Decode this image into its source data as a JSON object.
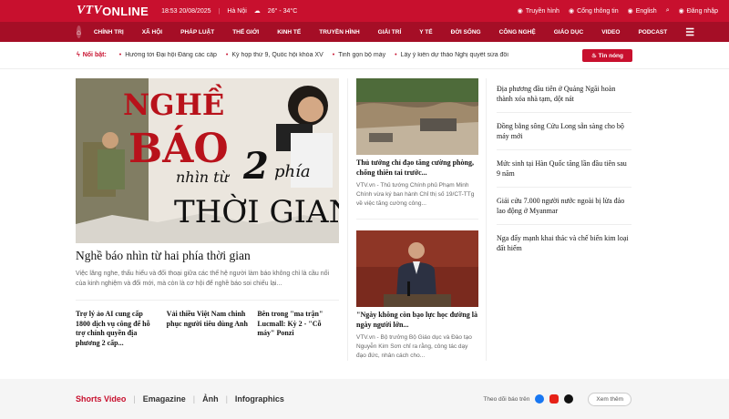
{
  "header": {
    "logo_vtv": "VTV",
    "logo_online": "ONLINE",
    "time": "18:53 20/08/2025",
    "location": "Hà Nội",
    "weather": "26° - 34°C",
    "links": [
      {
        "label": "Truyền hình",
        "icon": "tv-icon"
      },
      {
        "label": "Cổng thông tin",
        "icon": "portal-icon"
      },
      {
        "label": "English",
        "icon": "globe-icon"
      }
    ],
    "login": "Đăng nhập",
    "brand_color": "#c8102e"
  },
  "nav": {
    "items": [
      "CHÍNH TRỊ",
      "XÃ HỘI",
      "PHÁP LUẬT",
      "THẾ GIỚI",
      "KINH TẾ",
      "TRUYỀN HÌNH",
      "GIẢI TRÍ",
      "Y TẾ",
      "ĐỜI SỐNG",
      "CÔNG NGHỆ",
      "GIÁO DỤC",
      "VIDEO",
      "PODCAST"
    ]
  },
  "ticker": {
    "label": "Nổi bật:",
    "items": [
      "Hướng tới Đại hội Đảng các cấp",
      "Kỳ họp thứ 9, Quốc hội khóa XV",
      "Tinh gọn bộ máy",
      "Lấy ý kiến dự thảo Nghị quyết sửa đổi"
    ],
    "hot_button": "Tin nóng"
  },
  "hero": {
    "image_text_1": "NGHỀ",
    "image_text_2": "BÁO",
    "image_text_3": "nhìn từ",
    "image_text_4": "2",
    "image_text_5": "phía",
    "image_text_6": "THỜI GIAN",
    "title": "Nghề báo nhìn từ hai phía thời gian",
    "desc": "Việc lăng nghe, thấu hiểu và đối thoại giữa các thế hệ người làm báo không chỉ là cầu nối của kinh nghiệm và đổi mới, mà còn là cơ hội để nghề báo soi chiếu lại..."
  },
  "sub_stories": [
    "Trợ lý ảo AI cung cấp 1800 dịch vụ công để hỗ trợ chính quyền địa phương 2 cấp...",
    "Vải thiều Việt Nam chinh phục người tiêu dùng Anh",
    "Bên trong \"ma trận\" Lucmall: Kỳ 2 - \"Cỗ máy\" Ponzi"
  ],
  "cards": [
    {
      "title": "Thủ tướng chỉ đạo tăng cường phòng, chống thiên tai trước...",
      "desc": "VTV.vn - Thủ tướng Chính phủ Phạm Minh Chính vừa ký ban hành Chỉ thị số 19/CT-TTg về việc tăng cường công..."
    },
    {
      "title": "\"Ngày không còn bạo lực học đường là ngày người lớn...",
      "desc": "VTV.vn - Bộ trưởng Bộ Giáo dục và Đào tạo Nguyễn Kim Sơn chỉ ra rằng, công tác dạy đạo đức, nhân cách cho..."
    }
  ],
  "side_list": [
    "Địa phương đầu tiên ở Quảng Ngãi hoàn thành xóa nhà tạm, dột nát",
    "Đồng bằng sông Cửu Long sẵn sàng cho bộ máy mới",
    "Mức sinh tại Hàn Quốc tăng lần đầu tiên sau 9 năm",
    "Giải cứu 7.000 người nước ngoài bị lừa đảo lao động ở Myanmar",
    "Nga đẩy mạnh khai thác và chế biến kim loại đất hiếm"
  ],
  "footer": {
    "tabs": [
      "Shorts Video",
      "Emagazine",
      "Ảnh",
      "Infographics"
    ],
    "follow_label": "Theo dõi báo trên",
    "socials": [
      "facebook-icon",
      "youtube-icon",
      "tiktok-icon"
    ],
    "more_button": "Xem thêm"
  }
}
